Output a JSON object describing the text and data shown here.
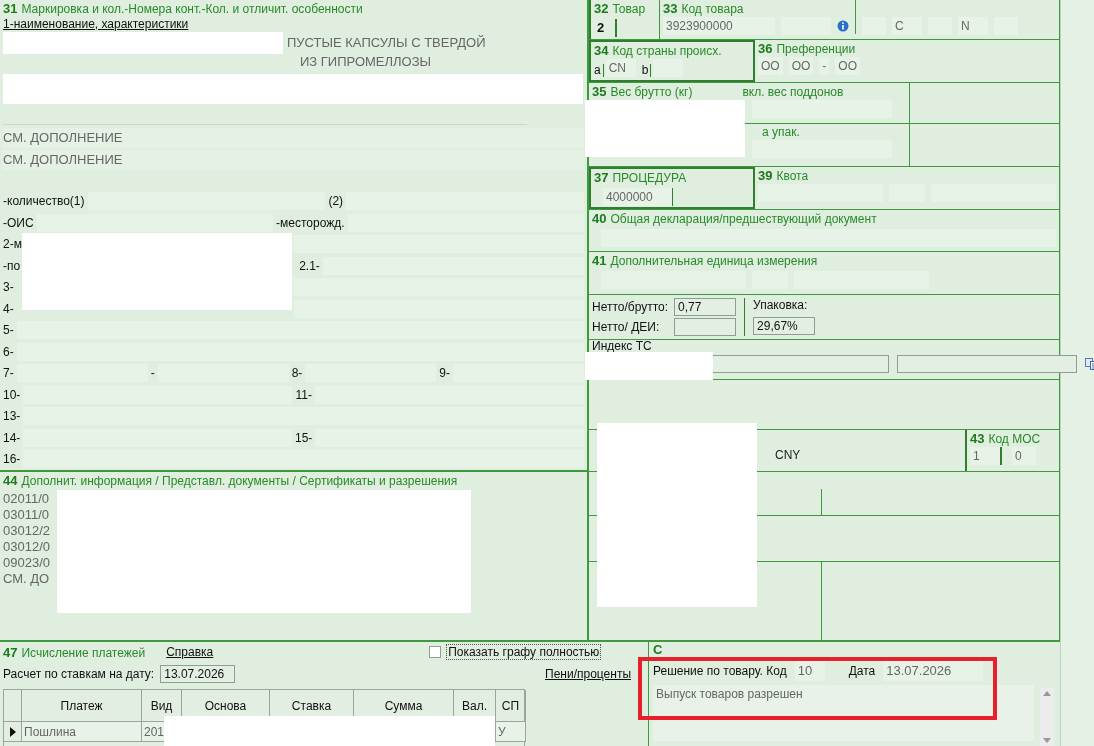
{
  "box31": {
    "number": "31",
    "title": "Маркировка и кол.-Номера конт.-Кол. и отличит. особенности",
    "subtitle": "1-наименование, характеристики",
    "description": [
      "ПУСТЫЕ КАПСУЛЫ С ТВЕРДОЙ",
      "ИЗ ГИПРОМЕЛЛОЗЫ"
    ],
    "notes": [
      "СМ. ДОПОЛНЕНИЕ",
      "СМ. ДОПОЛНЕНИЕ"
    ],
    "rows": [
      {
        "cells": [
          {
            "label": "-количество(1)"
          },
          {
            "label": "(2)"
          }
        ]
      },
      {
        "cells": [
          {
            "label": "-ОИС"
          },
          {
            "label": "-месторожд."
          }
        ]
      },
      {
        "cells": [
          {
            "label": "2-м"
          }
        ]
      },
      {
        "cells": [
          {
            "label": "-по"
          },
          {
            "label": "2.1-"
          }
        ]
      },
      {
        "cells": [
          {
            "label": "3-"
          }
        ]
      },
      {
        "cells": [
          {
            "label": "4-"
          }
        ]
      },
      {
        "cells": [
          {
            "label": "5-"
          }
        ]
      },
      {
        "cells": [
          {
            "label": "6-"
          }
        ]
      },
      {
        "cells": [
          {
            "label": "7-"
          },
          {
            "label": "-"
          },
          {
            "label": "8-"
          },
          {
            "label": "9-"
          }
        ]
      },
      {
        "cells": [
          {
            "label": "10-"
          },
          {
            "label": "11-"
          }
        ]
      },
      {
        "cells": [
          {
            "label": "13-"
          }
        ]
      },
      {
        "cells": [
          {
            "label": "14-"
          },
          {
            "label": "15-"
          }
        ]
      },
      {
        "cells": [
          {
            "label": "16-"
          }
        ]
      }
    ]
  },
  "box44": {
    "number": "44",
    "title": "Дополнит. информация / Представл. документы / Сертификаты и разрешения",
    "lines": [
      "02011/0",
      "03011/0",
      "03012/2",
      "03012/0",
      "09023/0",
      "СМ. ДО"
    ]
  },
  "box32": {
    "number": "32",
    "title": "Товар",
    "value": "2"
  },
  "box33": {
    "number": "33",
    "title": "Код товара",
    "code": "3923900000",
    "flags": [
      "C",
      "N"
    ]
  },
  "box34": {
    "number": "34",
    "title": "Код страны происх.",
    "a_label": "a",
    "a": "CN",
    "b_label": "b"
  },
  "box36": {
    "number": "36",
    "title": "Преференции",
    "codes": [
      "OO",
      "OO",
      "-",
      "OO"
    ]
  },
  "box35": {
    "number": "35",
    "title": "Вес брутто (кг)",
    "pallets_label": "вкл. вес поддонов"
  },
  "packaging_row": {
    "label": "а упак."
  },
  "box37": {
    "number": "37",
    "title": "ПРОЦЕДУРА",
    "code": "4000000"
  },
  "box39": {
    "number": "39",
    "title": "Квота"
  },
  "box40": {
    "number": "40",
    "title": "Общая декларация/предшествующий документ"
  },
  "box41": {
    "number": "41",
    "title": "Дополнительная единица измерения"
  },
  "ratios": {
    "net_gross_label": "Нетто/брутто:",
    "net_gross": "0,77",
    "net_unit_label": "Нетто/ ДЕИ:",
    "packaging_label": "Упаковка:",
    "packaging": "29,67%"
  },
  "vehicle_index": {
    "label": "Индекс ТС"
  },
  "currency": "CNY",
  "box43": {
    "number": "43",
    "title": "Код МОС",
    "values": [
      "1",
      "0"
    ]
  },
  "box47": {
    "number": "47",
    "title": "Исчисление платежей",
    "help_link": "Справка",
    "show_full": {
      "label": "Показать графу полностью",
      "checked": false
    },
    "rate_date_label": "Расчет по ставкам на дату:",
    "rate_date": "13.07.2026",
    "penalty_link": "Пени/проценты",
    "columns": [
      "Платеж",
      "Вид",
      "Основа",
      "Ставка",
      "Сумма",
      "Вал.",
      "СП"
    ],
    "rows": [
      {
        "payment": "Пошлина",
        "type_code": "201",
        "sp": "У",
        "selected": true
      }
    ]
  },
  "box_c": {
    "title": "C",
    "decision_label": "Решение по товару. Код",
    "decision_code": "10",
    "date_label": "Дата",
    "date": "13.07.2026",
    "comment": "Выпуск товаров разрешен",
    "highlighted": true
  }
}
